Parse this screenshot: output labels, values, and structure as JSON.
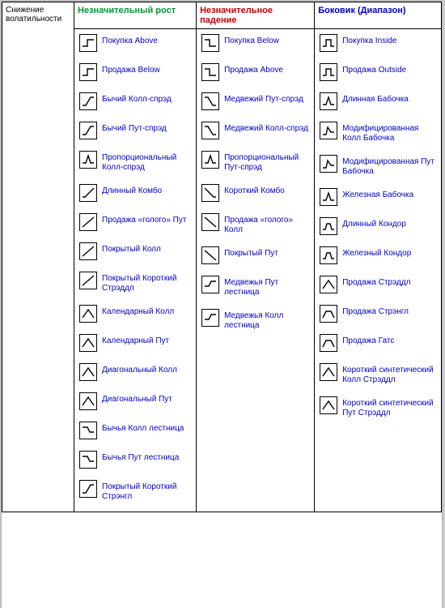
{
  "sidebar": {
    "label": "Снижение волатильности"
  },
  "columns": [
    {
      "header": "Незначительный рост",
      "headerClass": "hdr-green",
      "items": [
        {
          "label": "Покупка Above",
          "icon": "step-up"
        },
        {
          "label": "Продажа Below",
          "icon": "step-up"
        },
        {
          "label": "Бычий Колл-спрэд",
          "icon": "s-up"
        },
        {
          "label": "Бычий Пут-спрэд",
          "icon": "s-up"
        },
        {
          "label": "Пропорциональный Колл-спрэд",
          "icon": "spike-up"
        },
        {
          "label": "Длинный Комбо",
          "icon": "ramp-up"
        },
        {
          "label": "Продажа «голого» Пут",
          "icon": "line-up"
        },
        {
          "label": "Покрытый Колл",
          "icon": "line-up"
        },
        {
          "label": "Покрытый Короткий Стрэддл",
          "icon": "line-up"
        },
        {
          "label": "Календарный Колл",
          "icon": "hat"
        },
        {
          "label": "Календарный Пут",
          "icon": "hat"
        },
        {
          "label": "Диагональный Колл",
          "icon": "hat"
        },
        {
          "label": "Диагональный Пут",
          "icon": "hat"
        },
        {
          "label": "Бычья Колл лестница",
          "icon": "hat-down"
        },
        {
          "label": "Бычья Пут лестница",
          "icon": "hat-down"
        },
        {
          "label": "Покрытый Короткий Стрэнгл",
          "icon": "s-up"
        }
      ]
    },
    {
      "header": "Незначительное падение",
      "headerClass": "hdr-red",
      "items": [
        {
          "label": "Покупка Below",
          "icon": "step-down"
        },
        {
          "label": "Продажа Above",
          "icon": "step-down"
        },
        {
          "label": "Медвежий Пут-спрэд",
          "icon": "s-down"
        },
        {
          "label": "Медвежий Колл-спрэд",
          "icon": "s-down"
        },
        {
          "label": "Пропорциональный Пут-спрэд",
          "icon": "spike-up"
        },
        {
          "label": "Короткий Комбо",
          "icon": "ramp-down"
        },
        {
          "label": "Продажа «голого» Колл",
          "icon": "line-down"
        },
        {
          "label": "Покрытый Пут",
          "icon": "line-down"
        },
        {
          "label": "Медвежья Пут лестница",
          "icon": "hat-up"
        },
        {
          "label": "Медвежья Колл лестница",
          "icon": "hat-up"
        }
      ]
    },
    {
      "header": "Боковик (Диапазон)",
      "headerClass": "hdr-blue",
      "items": [
        {
          "label": "Покупка Inside",
          "icon": "pulse"
        },
        {
          "label": "Продажа Outside",
          "icon": "pulse"
        },
        {
          "label": "Длинная Бабочка",
          "icon": "spike-up"
        },
        {
          "label": "Модифицированная Колл Бабочка",
          "icon": "spike-sk"
        },
        {
          "label": "Модифицированная Пут Бабочка",
          "icon": "spike-sk"
        },
        {
          "label": "Железная Бабочка",
          "icon": "spike-up"
        },
        {
          "label": "Длинный Кондор",
          "icon": "mesa"
        },
        {
          "label": "Железный Кондор",
          "icon": "mesa"
        },
        {
          "label": "Продажа Стрэддл",
          "icon": "hat"
        },
        {
          "label": "Продажа Стрэнгл",
          "icon": "plateau"
        },
        {
          "label": "Продажа Гатс",
          "icon": "plateau"
        },
        {
          "label": "Короткий синтетический Колл Стрэддл",
          "icon": "hat"
        },
        {
          "label": "Короткий синтетический Пут Стрэддл",
          "icon": "hat"
        }
      ]
    }
  ]
}
